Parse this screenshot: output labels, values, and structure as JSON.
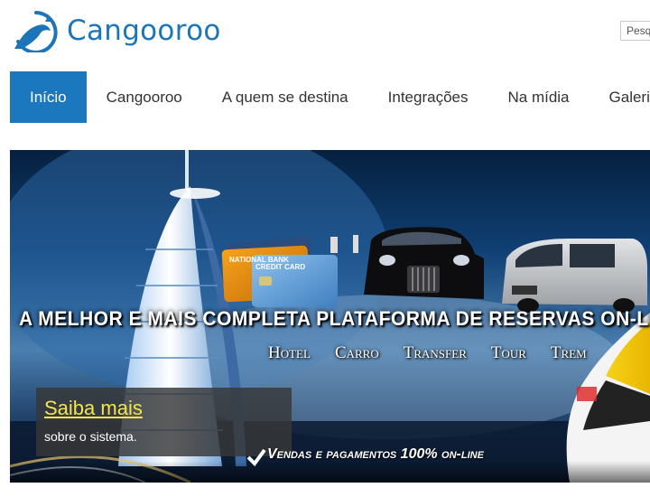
{
  "header": {
    "logo_text": "Cangooroo",
    "search_placeholder": "Pesq"
  },
  "nav": {
    "items": [
      {
        "label": "Início",
        "active": true
      },
      {
        "label": "Cangooroo"
      },
      {
        "label": "A quem se destina"
      },
      {
        "label": "Integrações"
      },
      {
        "label": "Na mídia"
      },
      {
        "label": "Galeria"
      }
    ]
  },
  "banner": {
    "headline": "A MELHOR E MAIS COMPLETA PLATAFORMA DE RESERVAS ON-LINE",
    "services": [
      "Hotel",
      "Carro",
      "Transfer",
      "Tour",
      "Trem"
    ],
    "saiba_link": "Saiba mais",
    "saiba_sub": "sobre o sistema.",
    "tagline": "Vendas e pagamentos 100% on-line",
    "card_bank": "NATIONAL BANK",
    "card_label": "CREDIT CARD"
  },
  "colors": {
    "brand_blue": "#1c75b8",
    "nav_active": "#1b78bf",
    "link_yellow": "#f5e44a"
  }
}
